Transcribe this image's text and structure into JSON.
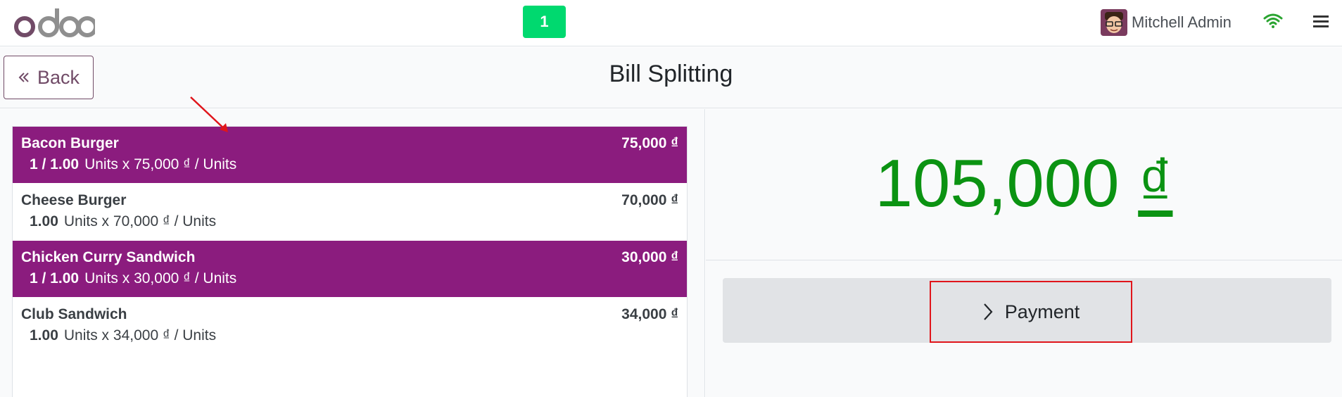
{
  "topbar": {
    "logo_text": "odoo",
    "order_badge": "1",
    "user_name": "Mitchell Admin",
    "icons": [
      "avatar",
      "wifi-icon",
      "hamburger-menu-icon"
    ]
  },
  "header": {
    "back_label": "Back",
    "title": "Bill Splitting"
  },
  "orderlines": [
    {
      "name": "Bacon Burger",
      "price": "75,000 ₫",
      "qty": "1 / 1.00",
      "detail": "Units x 75,000 ₫ / Units",
      "selected": true
    },
    {
      "name": "Cheese Burger",
      "price": "70,000 ₫",
      "qty": "1.00",
      "detail": "Units x 70,000 ₫ / Units",
      "selected": false
    },
    {
      "name": "Chicken Curry Sandwich",
      "price": "30,000 ₫",
      "qty": "1 / 1.00",
      "detail": "Units x 30,000 ₫ / Units",
      "selected": true
    },
    {
      "name": "Club Sandwich",
      "price": "34,000 ₫",
      "qty": "1.00",
      "detail": "Units x 34,000 ₫ / Units",
      "selected": false
    }
  ],
  "total": {
    "amount": "105,000",
    "currency": "₫"
  },
  "payment": {
    "label": "Payment"
  },
  "colors": {
    "selected_line": "#8b1c7e",
    "total_green": "#0b9312",
    "badge_green": "#00d96f",
    "brand_purple": "#714b67",
    "annotation_red": "#e0151b"
  }
}
